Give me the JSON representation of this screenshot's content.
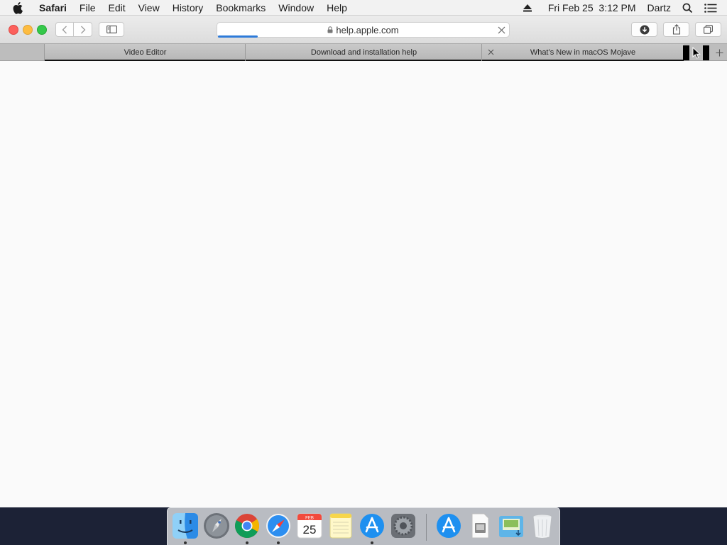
{
  "menubar": {
    "app_name": "Safari",
    "items": [
      "File",
      "Edit",
      "View",
      "History",
      "Bookmarks",
      "Window",
      "Help"
    ],
    "datetime": "Fri Feb 25  3:12 PM",
    "user": "Dartz"
  },
  "toolbar": {
    "address_text": "help.apple.com"
  },
  "tabs": [
    {
      "title": "Video Editor"
    },
    {
      "title": "Download and installation help"
    },
    {
      "title": "What’s New in macOS Mojave"
    }
  ],
  "dock": {
    "calendar_month": "FEB",
    "calendar_day": "25",
    "apps": [
      "finder-icon",
      "launchpad-icon",
      "chrome-icon",
      "safari-icon",
      "calendar-icon",
      "notes-icon",
      "app-store-icon",
      "system-preferences-icon",
      "app-store-download-icon",
      "preview-document-icon",
      "downloads-folder-icon",
      "trash-icon"
    ]
  }
}
